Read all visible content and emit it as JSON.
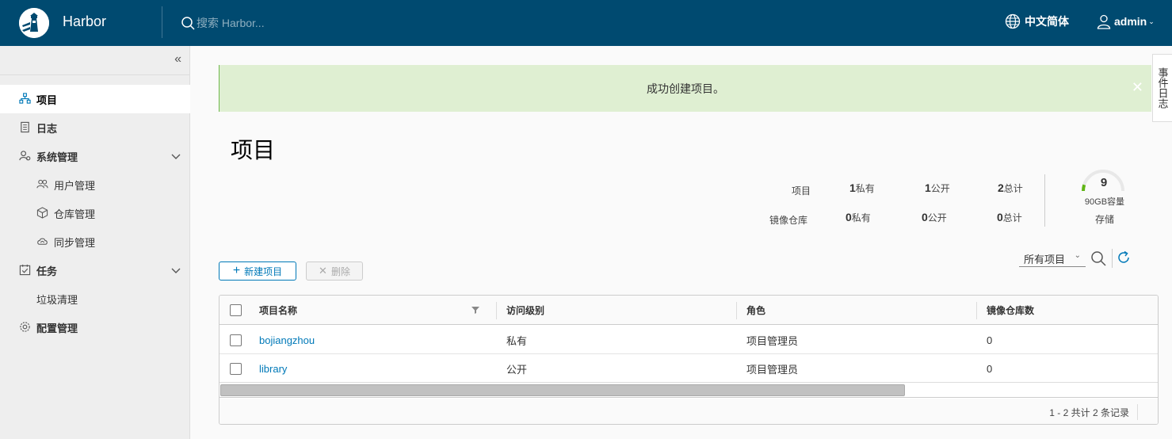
{
  "header": {
    "brand": "Harbor",
    "search_placeholder": "搜索 Harbor...",
    "language": "中文简体",
    "user": "admin",
    "bg_color": "#004a70"
  },
  "sidebar": {
    "items": [
      {
        "label": "项目",
        "icon": "projects-icon",
        "active": true
      },
      {
        "label": "日志",
        "icon": "logs-icon"
      },
      {
        "label": "系统管理",
        "icon": "admin-icon",
        "expandable": true
      },
      {
        "label": "用户管理",
        "icon": "users-icon",
        "sub": true
      },
      {
        "label": "仓库管理",
        "icon": "registries-icon",
        "sub": true
      },
      {
        "label": "同步管理",
        "icon": "replication-icon",
        "sub": true
      },
      {
        "label": "任务",
        "icon": "tasks-icon",
        "expandable": true
      },
      {
        "label": "垃圾清理",
        "sub": true
      },
      {
        "label": "配置管理",
        "icon": "config-icon"
      }
    ]
  },
  "alert": {
    "message": "成功创建项目。",
    "color": "#dfefd2"
  },
  "event_log_tab": "事件日志",
  "page_title": "项目",
  "stats": {
    "projects_label": "项目",
    "repos_label": "镜像仓库",
    "private_label": "私有",
    "public_label": "公开",
    "total_label": "总计",
    "projects": {
      "private": "1",
      "public": "1",
      "total": "2"
    },
    "repos": {
      "private": "0",
      "public": "0",
      "total": "0"
    },
    "storage_used": "9",
    "storage_capacity": "90GB容量",
    "storage_label": "存储",
    "storage_fraction": 0.1
  },
  "toolbar": {
    "new_project": "新建项目",
    "delete": "删除",
    "filter": "所有项目"
  },
  "table": {
    "columns": [
      "项目名称",
      "访问级别",
      "角色",
      "镜像仓库数"
    ],
    "rows": [
      {
        "name": "bojiangzhou",
        "access": "私有",
        "role": "项目管理员",
        "repos": "0"
      },
      {
        "name": "library",
        "access": "公开",
        "role": "项目管理员",
        "repos": "0"
      }
    ],
    "pagination": "1 - 2 共计 2 条记录"
  }
}
